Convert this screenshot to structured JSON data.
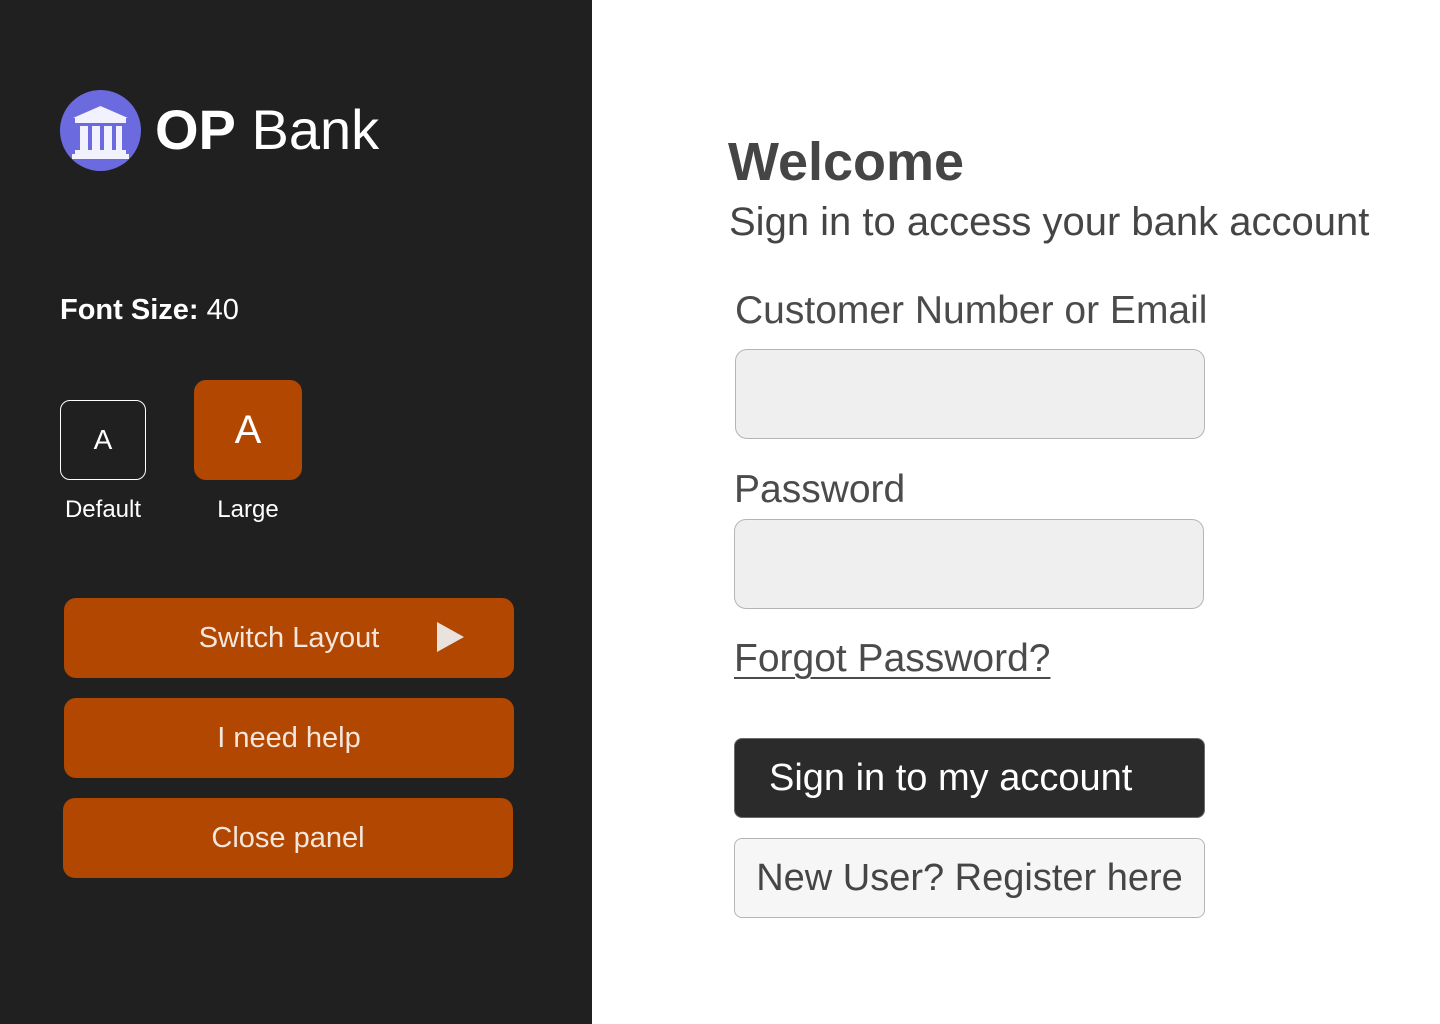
{
  "brand": {
    "name_strong": "OP",
    "name_light": " Bank",
    "logo_icon": "bank-building-icon",
    "logo_color": "#6b6bdf"
  },
  "sidebar": {
    "font_size_key": "Font Size:",
    "font_size_value": " 40",
    "size_options": [
      {
        "glyph": "A",
        "caption": "Default",
        "selected": false
      },
      {
        "glyph": "A",
        "caption": "Large",
        "selected": true
      }
    ],
    "buttons": {
      "switch_layout": "Switch Layout",
      "need_help": "I need help",
      "close_panel": "Close panel"
    },
    "accent_color": "#b14700",
    "background_color": "#202020"
  },
  "main": {
    "title": "Welcome",
    "subtitle": "Sign in to access your bank account",
    "fields": {
      "customer_label": "Customer Number or Email",
      "customer_value": "",
      "password_label": "Password",
      "password_value": ""
    },
    "forgot_password": "Forgot Password?",
    "sign_in_button": "Sign in to my account",
    "register_button": "New User? Register here"
  }
}
